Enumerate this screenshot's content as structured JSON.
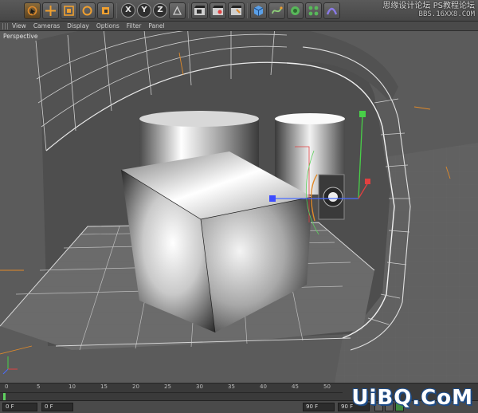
{
  "toolbar": {
    "tools": [
      {
        "name": "live-selection-icon"
      },
      {
        "name": "move-icon"
      },
      {
        "name": "scale-icon"
      },
      {
        "name": "rotate-icon"
      },
      {
        "name": "recent-tool-icon"
      }
    ],
    "axis_x": "X",
    "axis_y": "Y",
    "axis_z": "Z",
    "render_tools": [
      "render-view-icon",
      "render-picture-viewer-icon",
      "edit-render-settings-icon"
    ],
    "object_tools": [
      "cube-primitive-icon",
      "spline-pen-icon",
      "subdivision-surface-icon",
      "array-generator-icon",
      "deformer-icon"
    ],
    "accent": "#e08a2a"
  },
  "watermark_top": {
    "line1": "思缘设计论坛",
    "line2": "PS教程论坛",
    "line3": "BBS.16XX8.COM"
  },
  "viewport_menu": [
    "View",
    "Cameras",
    "Display",
    "Options",
    "Filter",
    "Panel"
  ],
  "viewport": {
    "label": "Perspective"
  },
  "timeline": {
    "ticks": [
      "0",
      "5",
      "10",
      "15",
      "20",
      "25",
      "30",
      "35",
      "40",
      "45",
      "50",
      "55",
      "60",
      "65",
      "70",
      "75",
      "80",
      "85",
      "90"
    ],
    "current_frame": "0 F",
    "start_frame": "0 F",
    "end_frame": "90 F",
    "preview_end": "90 F"
  },
  "corner_watermark": "UiBQ.CoM"
}
